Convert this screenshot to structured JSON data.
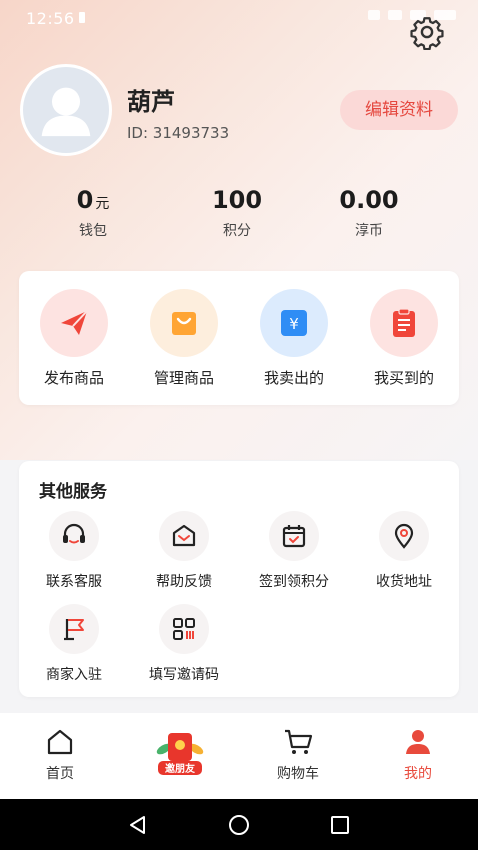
{
  "status_bar": {
    "time": "12:56"
  },
  "profile": {
    "name": "葫芦",
    "id_text": "ID: 31493733",
    "edit_label": "编辑资料"
  },
  "stats": [
    {
      "value": "0",
      "unit": "元",
      "label": "钱包"
    },
    {
      "value": "100",
      "unit": "",
      "label": "积分"
    },
    {
      "value": "0.00",
      "unit": "",
      "label": "淳币"
    }
  ],
  "quick_actions": [
    {
      "label": "发布商品",
      "icon": "paper-plane-icon",
      "color": "#f0463a"
    },
    {
      "label": "管理商品",
      "icon": "shopping-bag-icon",
      "color": "#ffa534"
    },
    {
      "label": "我卖出的",
      "icon": "yen-icon",
      "color": "#2f8df5"
    },
    {
      "label": "我买到的",
      "icon": "clipboard-icon",
      "color": "#f0463a"
    }
  ],
  "services": {
    "title": "其他服务",
    "items": [
      {
        "label": "联系客服",
        "icon": "headset-icon"
      },
      {
        "label": "帮助反馈",
        "icon": "envelope-icon"
      },
      {
        "label": "签到领积分",
        "icon": "calendar-check-icon"
      },
      {
        "label": "收货地址",
        "icon": "location-pin-icon"
      },
      {
        "label": "商家入驻",
        "icon": "flag-icon"
      },
      {
        "label": "填写邀请码",
        "icon": "qr-code-icon"
      }
    ]
  },
  "tabbar": {
    "home": "首页",
    "invite": "邀朋友",
    "cart": "购物车",
    "mine": "我的"
  },
  "colors": {
    "accent": "#e84a3c",
    "edit_bg": "#fbd9d7"
  }
}
